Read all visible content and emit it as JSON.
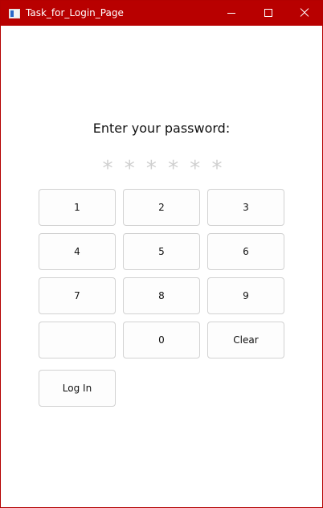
{
  "window": {
    "title": "Task_for_Login_Page",
    "accent_color": "#b80000"
  },
  "prompt": "Enter your password:",
  "password_mask": [
    "*",
    "*",
    "*",
    "*",
    "*",
    "*"
  ],
  "keypad": {
    "key1": "1",
    "key2": "2",
    "key3": "3",
    "key4": "4",
    "key5": "5",
    "key6": "6",
    "key7": "7",
    "key8": "8",
    "key9": "9",
    "key0": "0",
    "blank": "",
    "clear": "Clear",
    "login": "Log In"
  }
}
